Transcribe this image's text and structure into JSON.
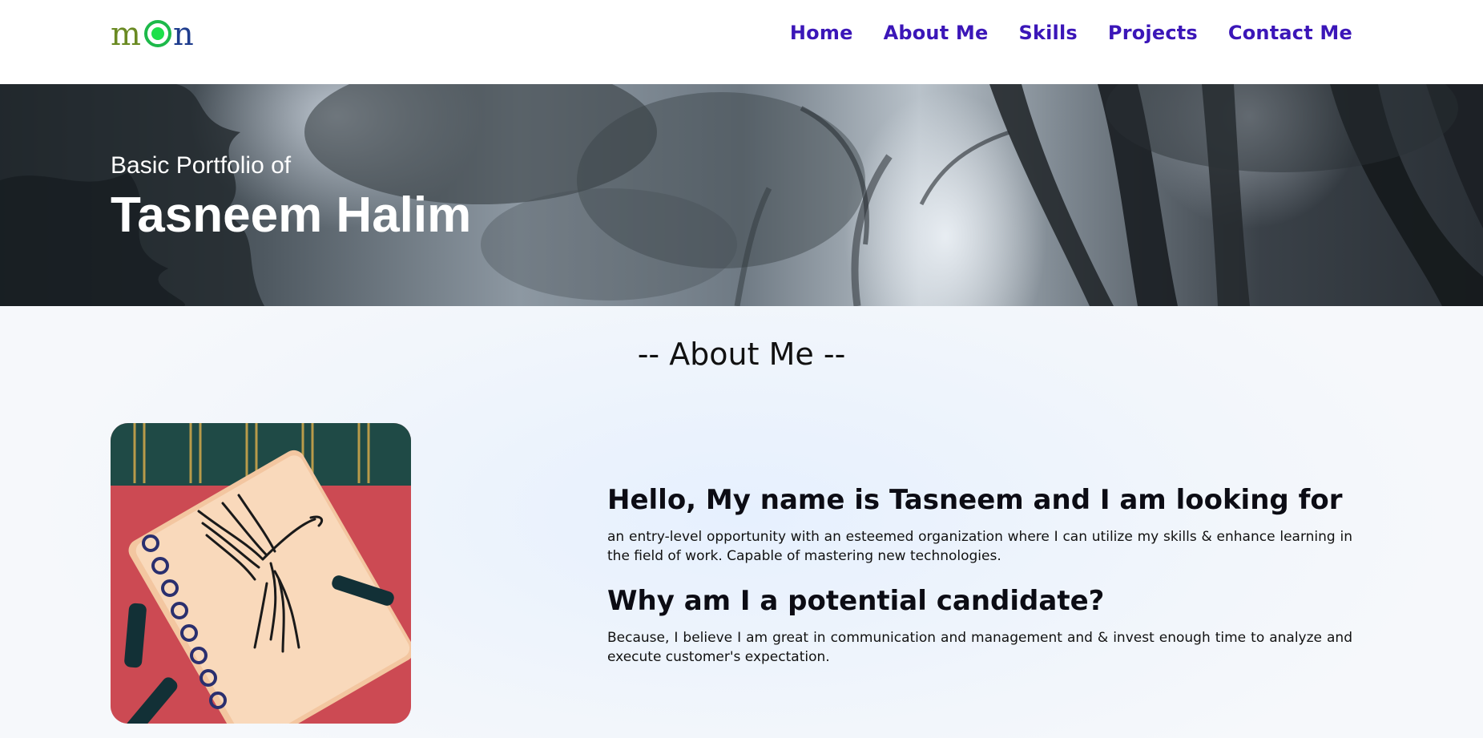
{
  "nav": {
    "logo": {
      "letter1": "m",
      "letter3": "n"
    },
    "links": [
      "Home",
      "About Me",
      "Skills",
      "Projects",
      "Contact Me"
    ]
  },
  "hero": {
    "subtitle": "Basic Portfolio of",
    "name": "Tasneem Halim"
  },
  "about": {
    "section_title": "-- About Me --",
    "greeting_heading": "Hello, My name is Tasneem and I am looking for",
    "greeting_text": "an entry-level opportunity with an esteemed organization where I can utilize my skills & enhance learning in the field of work. Capable of mastering new technologies.",
    "why_heading": "Why am I a potential candidate?",
    "why_text": "Because, I believe I am great in communication and management and & invest enough time to analyze and execute customer's expectation."
  },
  "colors": {
    "nav_link": "#3b16b8",
    "logo_green": "#1db94a",
    "logo_olive": "#6a8a22",
    "logo_blue": "#1f3d8e"
  }
}
